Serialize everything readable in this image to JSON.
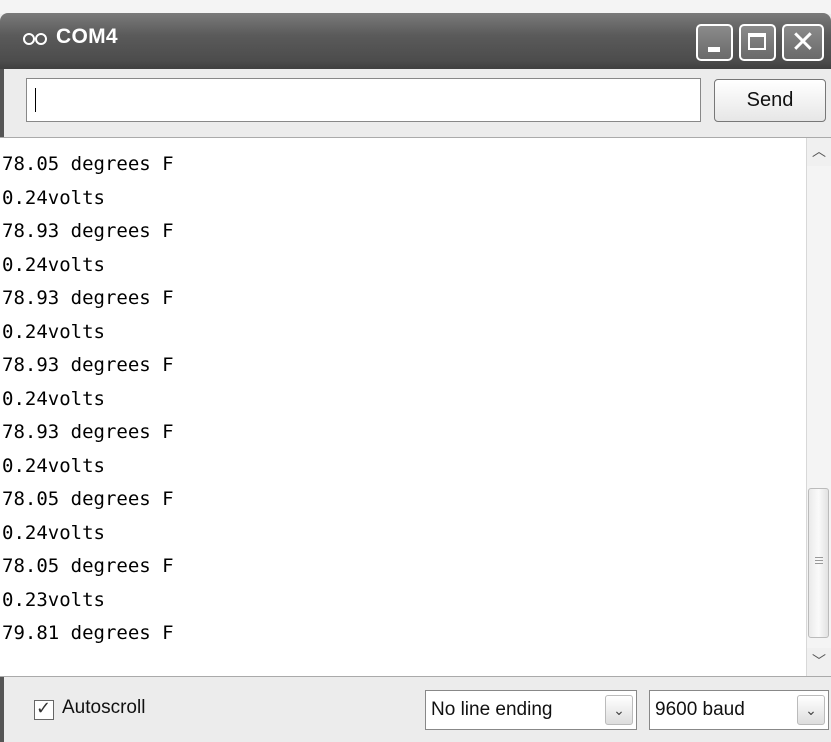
{
  "window": {
    "title": "COM4"
  },
  "input": {
    "value": "",
    "placeholder": ""
  },
  "send_label": "Send",
  "console_lines": [
    "78.05 degrees F",
    "0.24volts",
    "78.93 degrees F",
    "0.24volts",
    "78.93 degrees F",
    "0.24volts",
    "78.93 degrees F",
    "0.24volts",
    "78.93 degrees F",
    "0.24volts",
    "78.05 degrees F",
    "0.24volts",
    "78.05 degrees F",
    "0.23volts",
    "79.81 degrees F"
  ],
  "footer": {
    "autoscroll_label": "Autoscroll",
    "autoscroll_checked": true,
    "line_ending": "No line ending",
    "baud": "9600 baud"
  },
  "icons": {
    "app": "infinity-icon",
    "minimize": "minimize-icon",
    "maximize": "maximize-icon",
    "close": "close-icon",
    "scroll_up": "chevron-up-icon",
    "scroll_down": "chevron-down-icon",
    "dropdown": "chevron-down-icon",
    "check": "checkmark-icon"
  }
}
